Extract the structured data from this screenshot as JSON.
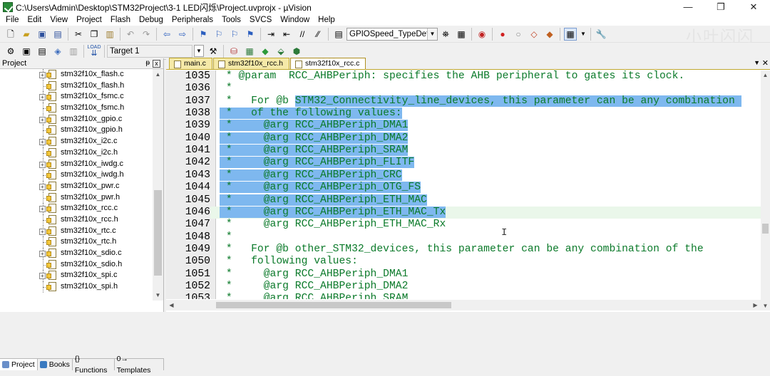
{
  "window": {
    "title": "C:\\Users\\Admin\\Desktop\\STM32Project\\3-1 LED闪烁\\Project.uvprojx - µVision",
    "controls": [
      "—",
      "❐",
      "✕"
    ],
    "watermark": "小叶闪闪"
  },
  "menu": [
    "File",
    "Edit",
    "View",
    "Project",
    "Flash",
    "Debug",
    "Peripherals",
    "Tools",
    "SVCS",
    "Window",
    "Help"
  ],
  "toolbar1": {
    "function_combo": "GPIOSpeed_TypeDef"
  },
  "toolbar2": {
    "target_combo": "Target 1",
    "load_label": "LOAD"
  },
  "project_panel": {
    "title": "Project",
    "pin": "ᵽ",
    "close": "x",
    "files": [
      "stm32f10x_flash.c",
      "stm32f10x_flash.h",
      "stm32f10x_fsmc.c",
      "stm32f10x_fsmc.h",
      "stm32f10x_gpio.c",
      "stm32f10x_gpio.h",
      "stm32f10x_i2c.c",
      "stm32f10x_i2c.h",
      "stm32f10x_iwdg.c",
      "stm32f10x_iwdg.h",
      "stm32f10x_pwr.c",
      "stm32f10x_pwr.h",
      "stm32f10x_rcc.c",
      "stm32f10x_rcc.h",
      "stm32f10x_rtc.c",
      "stm32f10x_rtc.h",
      "stm32f10x_sdio.c",
      "stm32f10x_sdio.h",
      "stm32f10x_spi.c",
      "stm32f10x_spi.h"
    ],
    "tabs": [
      "Project",
      "Books",
      "{} Functions",
      "0→ Templates"
    ]
  },
  "editor": {
    "tabs": [
      "main.c",
      "stm32f10x_rcc.h",
      "stm32f10x_rcc.c"
    ],
    "active_tab": 2,
    "lines": [
      {
        "n": "1035",
        "pre": " * @param  RCC_AHBPeriph: specifies the AHB peripheral to gates its clock.",
        "sel": ""
      },
      {
        "n": "1036",
        "pre": " *",
        "sel": ""
      },
      {
        "n": "1037",
        "pre": " *   For @b ",
        "sel": "STM32_Connectivity_line_devices, this parameter can be any combination "
      },
      {
        "n": "1038",
        "pre": " *   ",
        "sel": "of the following values:",
        "selStart": true
      },
      {
        "n": "1039",
        "pre": " *     ",
        "sel": "@arg RCC_AHBPeriph_DMA1",
        "selStart": true
      },
      {
        "n": "1040",
        "pre": " *     ",
        "sel": "@arg RCC_AHBPeriph_DMA2",
        "selStart": true
      },
      {
        "n": "1041",
        "pre": " *     ",
        "sel": "@arg RCC_AHBPeriph_SRAM",
        "selStart": true
      },
      {
        "n": "1042",
        "pre": " *     ",
        "sel": "@arg RCC_AHBPeriph_FLITF",
        "selStart": true
      },
      {
        "n": "1043",
        "pre": " *     ",
        "sel": "@arg RCC_AHBPeriph_CRC",
        "selStart": true
      },
      {
        "n": "1044",
        "pre": " *     ",
        "sel": "@arg RCC_AHBPeriph_OTG_FS",
        "selStart": true
      },
      {
        "n": "1045",
        "pre": " *     ",
        "sel": "@arg RCC_AHBPeriph_ETH_MAC",
        "selStart": true
      },
      {
        "n": "1046",
        "pre": " *     ",
        "sel": "@arg RCC_AHBPeriph_ETH_MAC_Tx",
        "selStart": true,
        "current": true
      },
      {
        "n": "1047",
        "pre": " *     @arg RCC_AHBPeriph_ETH_MAC_Rx",
        "sel": ""
      },
      {
        "n": "1048",
        "pre": " *",
        "sel": ""
      },
      {
        "n": "1049",
        "pre": " *   For @b other_STM32_devices, this parameter can be any combination of the",
        "sel": ""
      },
      {
        "n": "1050",
        "pre": " *   following values:",
        "sel": ""
      },
      {
        "n": "1051",
        "pre": " *     @arg RCC_AHBPeriph_DMA1",
        "sel": ""
      },
      {
        "n": "1052",
        "pre": " *     @arg RCC_AHBPeriph_DMA2",
        "sel": ""
      },
      {
        "n": "1053",
        "pre": " *     @arg RCC_AHBPeriph_SRAM",
        "sel": ""
      }
    ]
  },
  "colors": {
    "selection": "#7eb8ef",
    "comment": "#0b7a2a",
    "current_line": "#eaf7ea",
    "tab_active_border": "#c0a830"
  }
}
